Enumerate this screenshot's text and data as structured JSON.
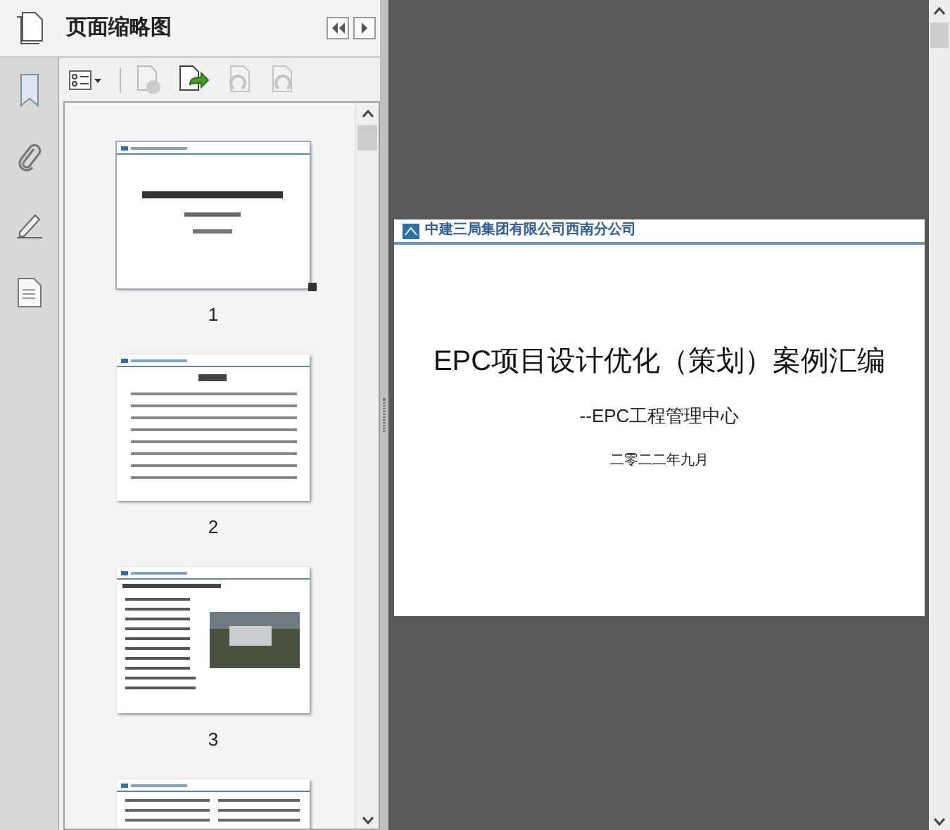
{
  "panel": {
    "title": "页面缩略图"
  },
  "thumbnails": [
    {
      "kind": "title",
      "label": "1",
      "selected": true
    },
    {
      "kind": "contents",
      "label": "2",
      "selected": false
    },
    {
      "kind": "photo",
      "label": "3",
      "selected": false
    },
    {
      "kind": "text",
      "selected": false
    }
  ],
  "page": {
    "header": "中建三局集团有限公司西南分公司",
    "title": "EPC项目设计优化（策划）案例汇编",
    "subtitle": "--EPC工程管理中心",
    "date": "二零二二年九月"
  }
}
